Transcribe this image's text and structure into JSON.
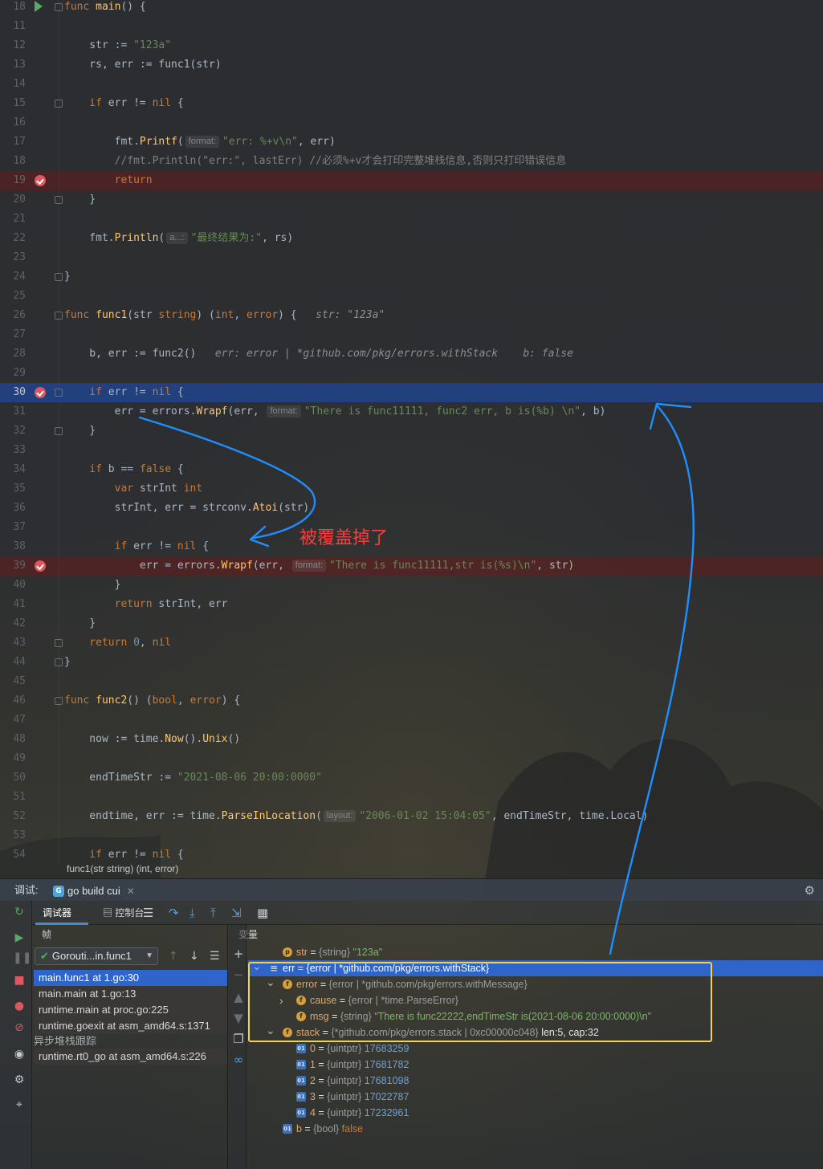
{
  "editor": {
    "lines": [
      {
        "n": "18",
        "segs": [
          [
            "kw",
            "func "
          ],
          [
            "fn",
            "main"
          ],
          [
            "id",
            "() {"
          ]
        ]
      },
      {
        "n": "11",
        "segs": []
      },
      {
        "n": "12",
        "segs": [
          [
            "id",
            "    str := "
          ],
          [
            "str",
            "\"123a\""
          ]
        ]
      },
      {
        "n": "13",
        "segs": [
          [
            "id",
            "    rs, err := func1(str)"
          ]
        ]
      },
      {
        "n": "14",
        "segs": []
      },
      {
        "n": "15",
        "segs": [
          [
            "kw",
            "    if "
          ],
          [
            "id",
            "err != "
          ],
          [
            "kw",
            "nil "
          ],
          [
            "id",
            "{"
          ]
        ]
      },
      {
        "n": "16",
        "segs": []
      },
      {
        "n": "17",
        "segs": [
          [
            "id",
            "        fmt."
          ],
          [
            "fn",
            "Printf"
          ],
          [
            "id",
            "("
          ],
          [
            "hint",
            "format:"
          ],
          [
            "str",
            "\"err: %+v\\n\""
          ],
          [
            "id",
            ", err)"
          ]
        ]
      },
      {
        "n": "18",
        "segs": [
          [
            "cm",
            "        //fmt.Println(\"err:\", lastErr) //必须%+v才会打印完整堆栈信息,否则只打印错误信息"
          ]
        ]
      },
      {
        "n": "19",
        "segs": [
          [
            "kw",
            "        return"
          ]
        ]
      },
      {
        "n": "20",
        "segs": [
          [
            "id",
            "    }"
          ]
        ]
      },
      {
        "n": "21",
        "segs": []
      },
      {
        "n": "22",
        "segs": [
          [
            "id",
            "    fmt."
          ],
          [
            "fn",
            "Println"
          ],
          [
            "id",
            "("
          ],
          [
            "hint",
            "a...:"
          ],
          [
            "str",
            "\"最终结果为:\""
          ],
          [
            "id",
            ", rs)"
          ]
        ]
      },
      {
        "n": "23",
        "segs": []
      },
      {
        "n": "24",
        "segs": [
          [
            "id",
            "}"
          ]
        ]
      },
      {
        "n": "25",
        "segs": []
      },
      {
        "n": "26",
        "segs": [
          [
            "kw",
            "func "
          ],
          [
            "fn",
            "func1"
          ],
          [
            "id",
            "(str "
          ],
          [
            "ty",
            "string"
          ],
          [
            "id",
            ") ("
          ],
          [
            "ty",
            "int"
          ],
          [
            "id",
            ", "
          ],
          [
            "ty",
            "error"
          ],
          [
            "id",
            ") {   "
          ],
          [
            "inl",
            "str: \"123a\""
          ]
        ]
      },
      {
        "n": "27",
        "segs": []
      },
      {
        "n": "28",
        "segs": [
          [
            "id",
            "    b, err := func2()   "
          ],
          [
            "inl",
            "err: error | *github.com/pkg/errors.withStack    b: false"
          ]
        ]
      },
      {
        "n": "29",
        "segs": []
      },
      {
        "n": "30",
        "segs": [
          [
            "kw",
            "    if "
          ],
          [
            "id",
            "err != "
          ],
          [
            "kw",
            "nil "
          ],
          [
            "id",
            "{"
          ]
        ]
      },
      {
        "n": "31",
        "segs": [
          [
            "id",
            "        err = errors."
          ],
          [
            "fn",
            "Wrapf"
          ],
          [
            "id",
            "(err, "
          ],
          [
            "hint",
            "format:"
          ],
          [
            "str",
            "\"There is func11111, func2 err, b is(%b) \\n\""
          ],
          [
            "id",
            ", b)"
          ]
        ]
      },
      {
        "n": "32",
        "segs": [
          [
            "id",
            "    }"
          ]
        ]
      },
      {
        "n": "33",
        "segs": []
      },
      {
        "n": "34",
        "segs": [
          [
            "kw",
            "    if "
          ],
          [
            "id",
            "b == "
          ],
          [
            "kw",
            "false "
          ],
          [
            "id",
            "{"
          ]
        ]
      },
      {
        "n": "35",
        "segs": [
          [
            "kw",
            "        var "
          ],
          [
            "id",
            "strInt "
          ],
          [
            "ty",
            "int"
          ]
        ]
      },
      {
        "n": "36",
        "segs": [
          [
            "id",
            "        strInt, err = strconv."
          ],
          [
            "fn",
            "Atoi"
          ],
          [
            "id",
            "(str)"
          ]
        ]
      },
      {
        "n": "37",
        "segs": []
      },
      {
        "n": "38",
        "segs": [
          [
            "kw",
            "        if "
          ],
          [
            "id",
            "err != "
          ],
          [
            "kw",
            "nil "
          ],
          [
            "id",
            "{"
          ]
        ]
      },
      {
        "n": "39",
        "segs": [
          [
            "id",
            "            err = errors."
          ],
          [
            "fn",
            "Wrapf"
          ],
          [
            "id",
            "(err, "
          ],
          [
            "hint",
            "format:"
          ],
          [
            "str",
            "\"There is func11111,str is(%s)\\n\""
          ],
          [
            "id",
            ", str)"
          ]
        ]
      },
      {
        "n": "40",
        "segs": [
          [
            "id",
            "        }"
          ]
        ]
      },
      {
        "n": "41",
        "segs": [
          [
            "kw",
            "        return "
          ],
          [
            "id",
            "strInt, err"
          ]
        ]
      },
      {
        "n": "42",
        "segs": [
          [
            "id",
            "    }"
          ]
        ]
      },
      {
        "n": "43",
        "segs": [
          [
            "kw",
            "    return "
          ],
          [
            "num",
            "0"
          ],
          [
            "id",
            ", "
          ],
          [
            "kw",
            "nil"
          ]
        ]
      },
      {
        "n": "44",
        "segs": [
          [
            "id",
            "}"
          ]
        ]
      },
      {
        "n": "45",
        "segs": []
      },
      {
        "n": "46",
        "segs": [
          [
            "kw",
            "func "
          ],
          [
            "fn",
            "func2"
          ],
          [
            "id",
            "() ("
          ],
          [
            "ty",
            "bool"
          ],
          [
            "id",
            ", "
          ],
          [
            "ty",
            "error"
          ],
          [
            "id",
            ") {"
          ]
        ]
      },
      {
        "n": "47",
        "segs": []
      },
      {
        "n": "48",
        "segs": [
          [
            "id",
            "    now := time."
          ],
          [
            "fn",
            "Now"
          ],
          [
            "id",
            "()."
          ],
          [
            "fn",
            "Unix"
          ],
          [
            "id",
            "()"
          ]
        ]
      },
      {
        "n": "49",
        "segs": []
      },
      {
        "n": "50",
        "segs": [
          [
            "id",
            "    endTimeStr := "
          ],
          [
            "str",
            "\"2021-08-06 20:00:0000\""
          ]
        ]
      },
      {
        "n": "51",
        "segs": []
      },
      {
        "n": "52",
        "segs": [
          [
            "id",
            "    endtime, err := time."
          ],
          [
            "fn",
            "ParseInLocation"
          ],
          [
            "id",
            "("
          ],
          [
            "hint",
            "layout:"
          ],
          [
            "str",
            "\"2006-01-02 15:04:05\""
          ],
          [
            "id",
            ", endTimeStr, time.Local)"
          ]
        ]
      },
      {
        "n": "53",
        "segs": []
      },
      {
        "n": "54",
        "segs": [
          [
            "kw",
            "    if "
          ],
          [
            "id",
            "err != "
          ],
          [
            "kw",
            "nil "
          ],
          [
            "id",
            "{"
          ]
        ]
      }
    ],
    "breadcrumb": "func1(str string) (int, error)",
    "annotation": "被覆盖掉了"
  },
  "debug": {
    "label": "调试:",
    "run_tab": "go build cui",
    "tab_debugger": "调试器",
    "tab_console": "控制台",
    "frames_header": "帧",
    "variables_header": "变量",
    "goroutine": "Gorouti...in.func1",
    "frames": [
      {
        "text": "main.func1 at 1.go:30",
        "state": "sel"
      },
      {
        "text": "main.main at 1.go:13",
        "state": "dim"
      },
      {
        "text": "runtime.main at proc.go:225",
        "state": "dim"
      },
      {
        "text": "runtime.goexit at asm_amd64.s:1371",
        "state": "dim"
      },
      {
        "text": "异步堆栈跟踪",
        "state": "group"
      },
      {
        "text": "runtime.rt0_go at asm_amd64.s:226",
        "state": "dim"
      }
    ],
    "variables": [
      {
        "indent": 1,
        "badge": "p",
        "name": "str",
        "type": "{string}",
        "value": "\"123a\"",
        "vclass": "vval"
      },
      {
        "indent": 0,
        "arrow": "v",
        "badge": "lst",
        "name": "err",
        "type": "{error | *github.com/pkg/errors.withStack}",
        "value": "",
        "vclass": "vval",
        "selected": true
      },
      {
        "indent": 1,
        "arrow": "v",
        "badge": "f",
        "name": "error",
        "type": "{error | *github.com/pkg/errors.withMessage}",
        "value": "",
        "vclass": "vval"
      },
      {
        "indent": 2,
        "arrow": ">",
        "badge": "f",
        "name": "cause",
        "type": "{error | *time.ParseError}",
        "value": "",
        "vclass": "vval"
      },
      {
        "indent": 2,
        "badge": "f",
        "name": "msg",
        "type": "{string}",
        "value": "\"There is func22222,endTimeStr is(2021-08-06 20:00:0000)\\n\"",
        "vclass": "vval"
      },
      {
        "indent": 1,
        "arrow": "v",
        "badge": "f",
        "name": "stack",
        "type": "{*github.com/pkg/errors.stack | 0xc00000c048}",
        "value": "len:5, cap:32",
        "vclass": "vmeta"
      },
      {
        "indent": 2,
        "badge": "sq",
        "name": "0",
        "type": "{uintptr}",
        "value": "17683259",
        "vclass": "vnum"
      },
      {
        "indent": 2,
        "badge": "sq",
        "name": "1",
        "type": "{uintptr}",
        "value": "17681782",
        "vclass": "vnum"
      },
      {
        "indent": 2,
        "badge": "sq",
        "name": "2",
        "type": "{uintptr}",
        "value": "17681098",
        "vclass": "vnum"
      },
      {
        "indent": 2,
        "badge": "sq",
        "name": "3",
        "type": "{uintptr}",
        "value": "17022787",
        "vclass": "vnum"
      },
      {
        "indent": 2,
        "badge": "sq",
        "name": "4",
        "type": "{uintptr}",
        "value": "17232961",
        "vclass": "vnum"
      },
      {
        "indent": 1,
        "badge": "sq",
        "name": "b",
        "type": "{bool}",
        "value": "false",
        "vclass": "vkw"
      }
    ]
  },
  "colors": {
    "annotation": "#ff3b3b",
    "arrow": "#1e8fff",
    "highlight_box": "#f4d24a",
    "execution_line": "#214283",
    "selection": "#2f65ca"
  }
}
